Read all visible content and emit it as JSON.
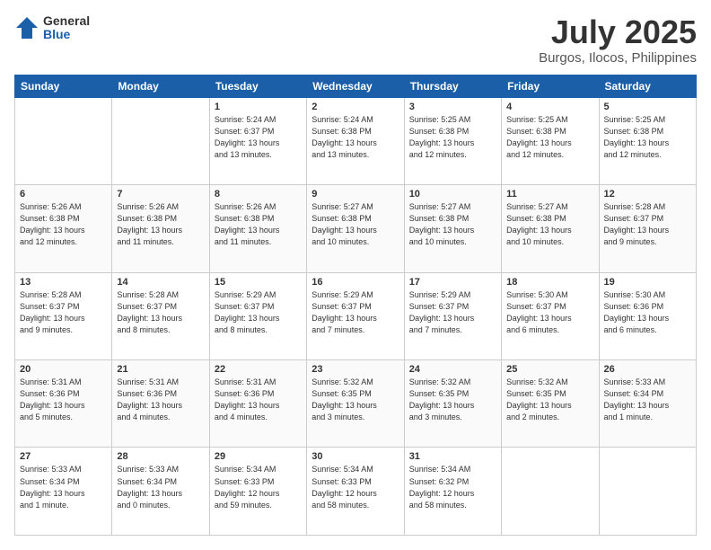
{
  "header": {
    "logo_general": "General",
    "logo_blue": "Blue",
    "month_title": "July 2025",
    "location": "Burgos, Ilocos, Philippines"
  },
  "days_of_week": [
    "Sunday",
    "Monday",
    "Tuesday",
    "Wednesday",
    "Thursday",
    "Friday",
    "Saturday"
  ],
  "weeks": [
    [
      {
        "day": "",
        "info": ""
      },
      {
        "day": "",
        "info": ""
      },
      {
        "day": "1",
        "info": "Sunrise: 5:24 AM\nSunset: 6:37 PM\nDaylight: 13 hours\nand 13 minutes."
      },
      {
        "day": "2",
        "info": "Sunrise: 5:24 AM\nSunset: 6:38 PM\nDaylight: 13 hours\nand 13 minutes."
      },
      {
        "day": "3",
        "info": "Sunrise: 5:25 AM\nSunset: 6:38 PM\nDaylight: 13 hours\nand 12 minutes."
      },
      {
        "day": "4",
        "info": "Sunrise: 5:25 AM\nSunset: 6:38 PM\nDaylight: 13 hours\nand 12 minutes."
      },
      {
        "day": "5",
        "info": "Sunrise: 5:25 AM\nSunset: 6:38 PM\nDaylight: 13 hours\nand 12 minutes."
      }
    ],
    [
      {
        "day": "6",
        "info": "Sunrise: 5:26 AM\nSunset: 6:38 PM\nDaylight: 13 hours\nand 12 minutes."
      },
      {
        "day": "7",
        "info": "Sunrise: 5:26 AM\nSunset: 6:38 PM\nDaylight: 13 hours\nand 11 minutes."
      },
      {
        "day": "8",
        "info": "Sunrise: 5:26 AM\nSunset: 6:38 PM\nDaylight: 13 hours\nand 11 minutes."
      },
      {
        "day": "9",
        "info": "Sunrise: 5:27 AM\nSunset: 6:38 PM\nDaylight: 13 hours\nand 10 minutes."
      },
      {
        "day": "10",
        "info": "Sunrise: 5:27 AM\nSunset: 6:38 PM\nDaylight: 13 hours\nand 10 minutes."
      },
      {
        "day": "11",
        "info": "Sunrise: 5:27 AM\nSunset: 6:38 PM\nDaylight: 13 hours\nand 10 minutes."
      },
      {
        "day": "12",
        "info": "Sunrise: 5:28 AM\nSunset: 6:37 PM\nDaylight: 13 hours\nand 9 minutes."
      }
    ],
    [
      {
        "day": "13",
        "info": "Sunrise: 5:28 AM\nSunset: 6:37 PM\nDaylight: 13 hours\nand 9 minutes."
      },
      {
        "day": "14",
        "info": "Sunrise: 5:28 AM\nSunset: 6:37 PM\nDaylight: 13 hours\nand 8 minutes."
      },
      {
        "day": "15",
        "info": "Sunrise: 5:29 AM\nSunset: 6:37 PM\nDaylight: 13 hours\nand 8 minutes."
      },
      {
        "day": "16",
        "info": "Sunrise: 5:29 AM\nSunset: 6:37 PM\nDaylight: 13 hours\nand 7 minutes."
      },
      {
        "day": "17",
        "info": "Sunrise: 5:29 AM\nSunset: 6:37 PM\nDaylight: 13 hours\nand 7 minutes."
      },
      {
        "day": "18",
        "info": "Sunrise: 5:30 AM\nSunset: 6:37 PM\nDaylight: 13 hours\nand 6 minutes."
      },
      {
        "day": "19",
        "info": "Sunrise: 5:30 AM\nSunset: 6:36 PM\nDaylight: 13 hours\nand 6 minutes."
      }
    ],
    [
      {
        "day": "20",
        "info": "Sunrise: 5:31 AM\nSunset: 6:36 PM\nDaylight: 13 hours\nand 5 minutes."
      },
      {
        "day": "21",
        "info": "Sunrise: 5:31 AM\nSunset: 6:36 PM\nDaylight: 13 hours\nand 4 minutes."
      },
      {
        "day": "22",
        "info": "Sunrise: 5:31 AM\nSunset: 6:36 PM\nDaylight: 13 hours\nand 4 minutes."
      },
      {
        "day": "23",
        "info": "Sunrise: 5:32 AM\nSunset: 6:35 PM\nDaylight: 13 hours\nand 3 minutes."
      },
      {
        "day": "24",
        "info": "Sunrise: 5:32 AM\nSunset: 6:35 PM\nDaylight: 13 hours\nand 3 minutes."
      },
      {
        "day": "25",
        "info": "Sunrise: 5:32 AM\nSunset: 6:35 PM\nDaylight: 13 hours\nand 2 minutes."
      },
      {
        "day": "26",
        "info": "Sunrise: 5:33 AM\nSunset: 6:34 PM\nDaylight: 13 hours\nand 1 minute."
      }
    ],
    [
      {
        "day": "27",
        "info": "Sunrise: 5:33 AM\nSunset: 6:34 PM\nDaylight: 13 hours\nand 1 minute."
      },
      {
        "day": "28",
        "info": "Sunrise: 5:33 AM\nSunset: 6:34 PM\nDaylight: 13 hours\nand 0 minutes."
      },
      {
        "day": "29",
        "info": "Sunrise: 5:34 AM\nSunset: 6:33 PM\nDaylight: 12 hours\nand 59 minutes."
      },
      {
        "day": "30",
        "info": "Sunrise: 5:34 AM\nSunset: 6:33 PM\nDaylight: 12 hours\nand 58 minutes."
      },
      {
        "day": "31",
        "info": "Sunrise: 5:34 AM\nSunset: 6:32 PM\nDaylight: 12 hours\nand 58 minutes."
      },
      {
        "day": "",
        "info": ""
      },
      {
        "day": "",
        "info": ""
      }
    ]
  ]
}
